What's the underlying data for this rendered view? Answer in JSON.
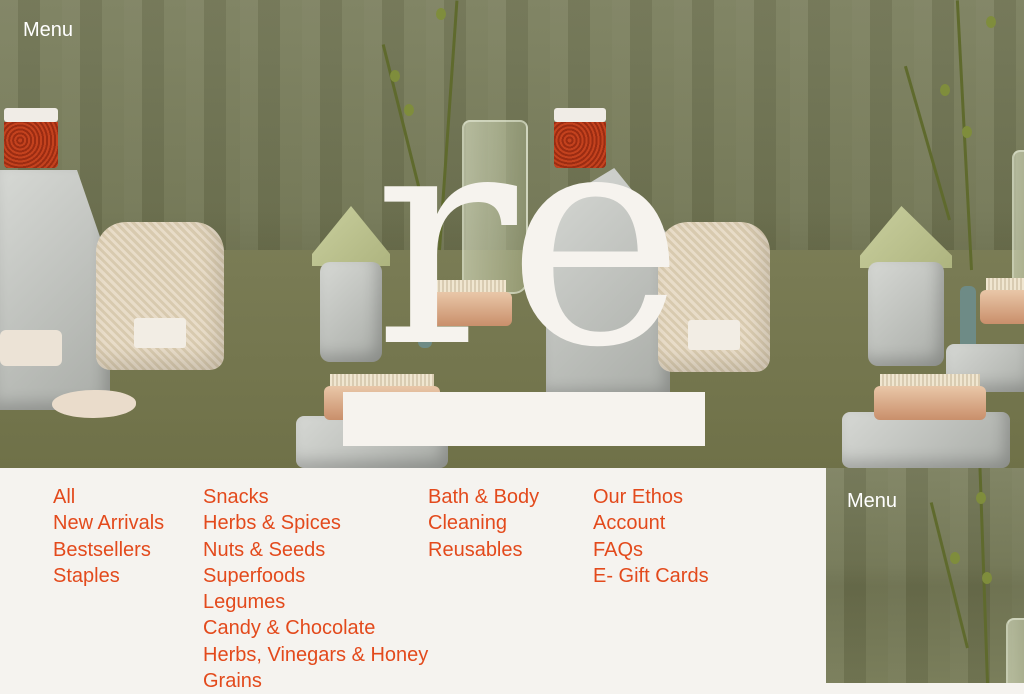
{
  "header": {
    "menu_label": "Menu",
    "logo_text": "re"
  },
  "nav": {
    "columns": [
      [
        "All",
        "New Arrivals",
        "Bestsellers",
        "Staples"
      ],
      [
        "Snacks",
        "Herbs & Spices",
        "Nuts & Seeds",
        "Superfoods",
        "Legumes",
        "Candy & Chocolate",
        "Herbs, Vinegars & Honey",
        "Grains"
      ],
      [
        "Bath & Body",
        "Cleaning",
        "Reusables"
      ],
      [
        "Our Ethos",
        "Account",
        "FAQs",
        "E- Gift Cards"
      ]
    ]
  },
  "side_panel": {
    "menu_label": "Menu"
  },
  "colors": {
    "accent": "#e34a1c",
    "background": "#f5f3ef",
    "hero_olive": "#6f7350",
    "logo": "#f6f3ee"
  }
}
